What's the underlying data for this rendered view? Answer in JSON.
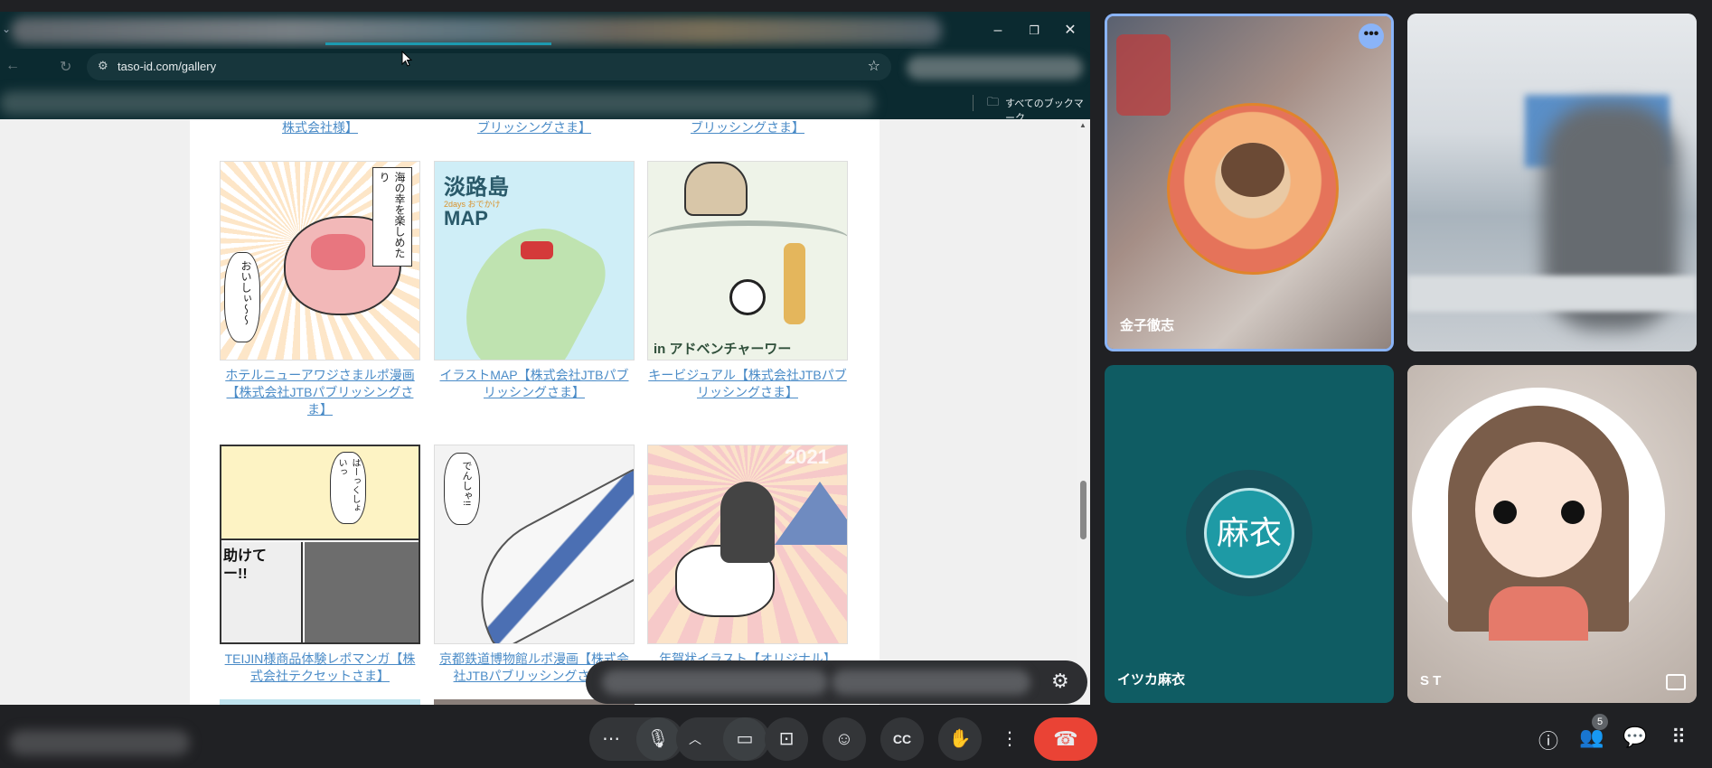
{
  "browser": {
    "url": "taso-id.com/gallery",
    "bookmarks_all_label": "すべてのブックマーク"
  },
  "gallery": {
    "top_captions": [
      "株式会社様】",
      "ブリッシングさま】",
      "ブリッシングさま】"
    ],
    "items": [
      {
        "caption": "ホテルニューアワジさまルポ漫画【株式会社JTBパブリッシングさま】",
        "art": {
          "t1": "海の幸を楽しめたり",
          "t2": "おいしぃ〜〜"
        }
      },
      {
        "caption": "イラストMAP【株式会社JTBパブリッシングさま】",
        "art": {
          "t1": "淡路島",
          "t2": "2days おでかけ",
          "t3": "MAP"
        }
      },
      {
        "caption": "キービジュアル【株式会社JTBパブリッシングさま】",
        "art": {
          "t1": "in アドベンチャーワー"
        }
      },
      {
        "caption": "TEIJIN様商品体験レポマンガ【株式会社テクセットさま】",
        "art": {
          "t1": "はーっくしょいっ",
          "t2": "助けてー!!"
        }
      },
      {
        "caption": "京都鉄道博物館ルポ漫画【株式会社JTBパブリッシングさま】",
        "art": {
          "t1": "でんしゃ!!"
        }
      },
      {
        "caption": "年賀状イラスト【オリジナル】",
        "art": {
          "t1": "2021"
        }
      }
    ]
  },
  "meet": {
    "participants": [
      {
        "name": "金子徹志",
        "colors": {
          "ring": "#8ab4f8"
        }
      },
      {
        "name": ""
      },
      {
        "name": "イツカ麻衣",
        "avatar_text": "麻衣",
        "colors": {
          "bg": "#0f5c63",
          "avatar": "#1e9aa5"
        }
      },
      {
        "name": "S T"
      }
    ],
    "people_count": "5",
    "controls": [
      "more-options",
      "microphone",
      "camera-options",
      "camera",
      "present-screen",
      "reactions",
      "captions",
      "raise-hand",
      "more-actions",
      "leave-call"
    ],
    "colors": {
      "leave": "#ea4335"
    }
  }
}
